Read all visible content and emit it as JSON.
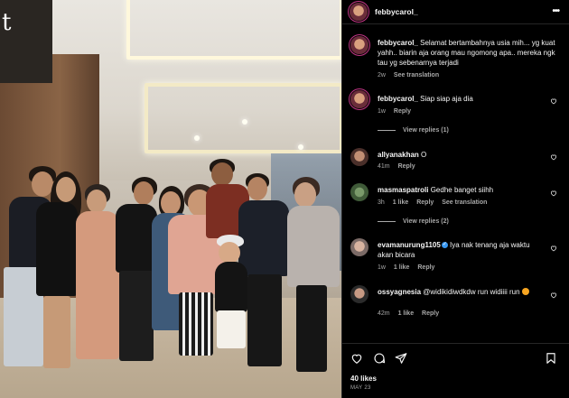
{
  "photo": {
    "store_sign": "t"
  },
  "post": {
    "username": "febbycarol_",
    "likes": "40 likes",
    "date": "MAY 23"
  },
  "comments": [
    {
      "username": "febbycarol_",
      "text": "Selamat bertambahnya usia mih... yg kuat yahh.. biarin aja orang mau ngomong apa.. mereka ngk tau yg sebenarnya terjadi",
      "time": "2w",
      "action": "See translation"
    },
    {
      "username": "febbycarol_",
      "text": "Siap siap aja dia",
      "time": "1w",
      "reply": "Reply",
      "view_replies": "View replies (1)"
    },
    {
      "username": "allyanakhan",
      "text": "O",
      "time": "41m",
      "reply": "Reply"
    },
    {
      "username": "masmaspatroli",
      "text": "Gedhe banget siihh",
      "time": "3h",
      "likes": "1 like",
      "reply": "Reply",
      "action": "See translation",
      "view_replies": "View replies (2)"
    },
    {
      "username": "evamanurung1105",
      "text": "Iya nak tenang aja waktu akan bicara",
      "time": "1w",
      "likes": "1 like",
      "reply": "Reply"
    },
    {
      "username": "ossyagnesia",
      "text": "@widikidiwdkdw run widiiii run",
      "time": "42m",
      "likes": "1 like",
      "reply": "Reply"
    }
  ],
  "icons": {
    "like": "heart-icon",
    "comment": "comment-icon",
    "share": "send-icon",
    "save": "bookmark-icon",
    "more": "more-icon",
    "verified": "verified-badge-icon"
  },
  "colors": {
    "background": "#000000",
    "text": "#f5f5f5",
    "muted": "#a8a8a8",
    "verified": "#3897f0"
  }
}
